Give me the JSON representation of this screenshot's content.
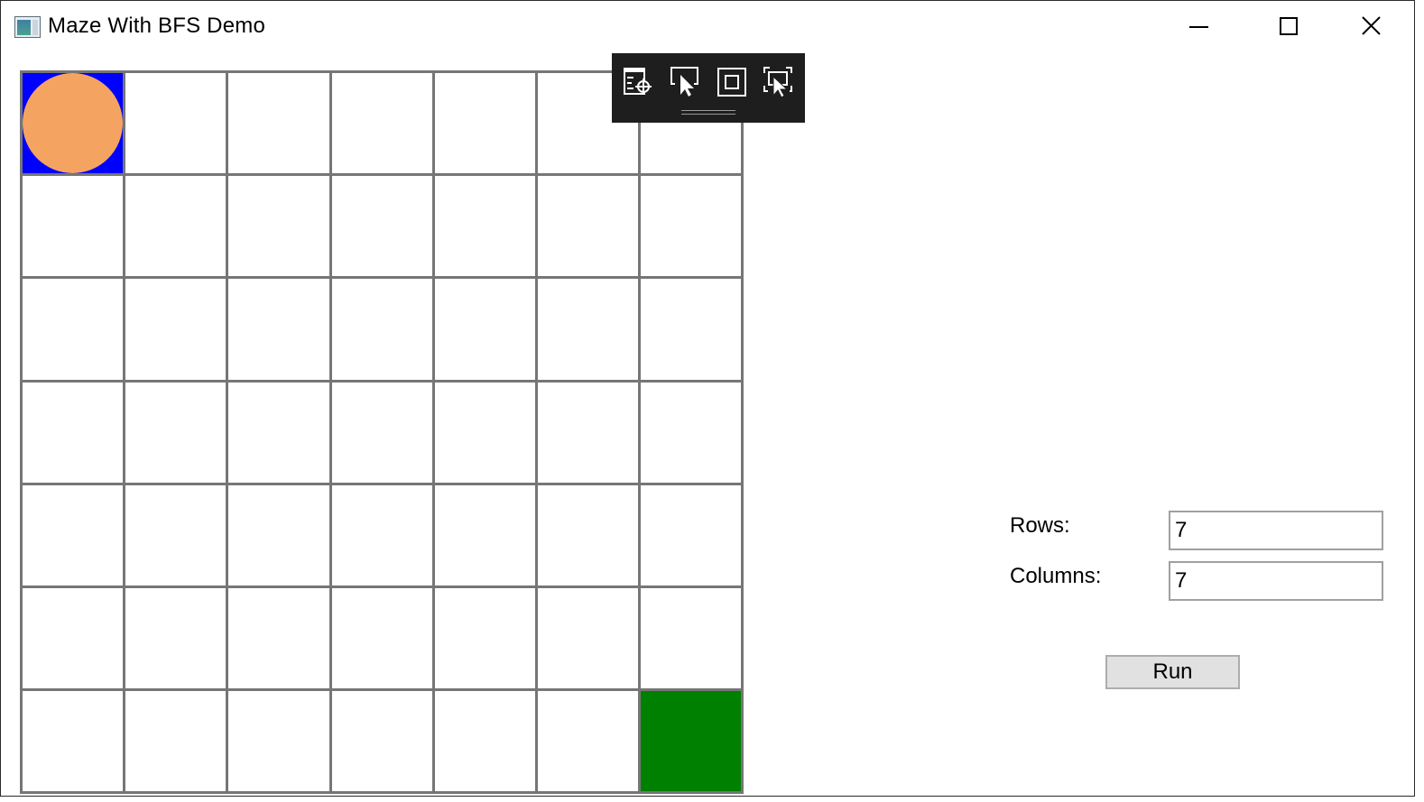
{
  "window": {
    "title": "Maze With BFS Demo",
    "icon": "app-window-icon",
    "controls": [
      "minimize-icon",
      "maximize-icon",
      "close-icon"
    ]
  },
  "maze": {
    "rows": 7,
    "columns": 7,
    "start": {
      "row": 0,
      "col": 0,
      "color": "#0000ff"
    },
    "goal": {
      "row": 6,
      "col": 6,
      "color": "#008000"
    },
    "player": {
      "row": 0,
      "col": 0,
      "color": "#f4a460"
    },
    "wall_color": "#767676"
  },
  "dev_toolbar": {
    "tools": [
      "select-element-icon",
      "select-cursor-icon",
      "display-layout-icon",
      "track-focus-icon"
    ]
  },
  "form": {
    "rows_label": "Rows:",
    "rows_value": "7",
    "columns_label": "Columns:",
    "columns_value": "7",
    "run_label": "Run"
  }
}
